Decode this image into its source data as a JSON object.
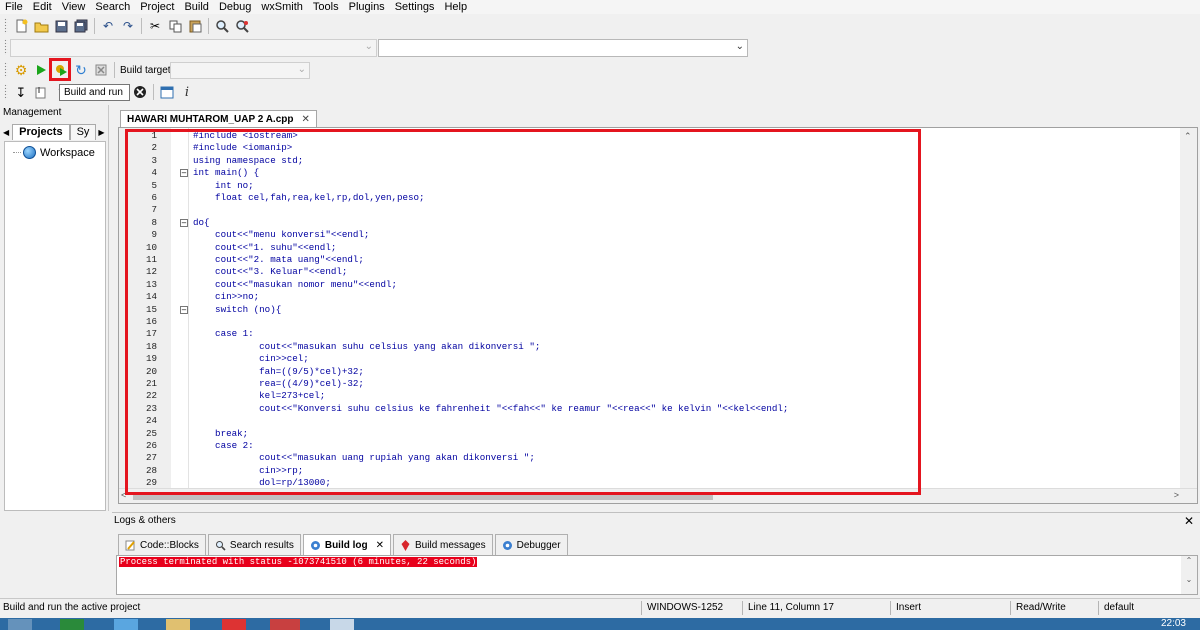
{
  "menu": [
    "File",
    "Edit",
    "View",
    "Search",
    "Project",
    "Build",
    "Debug",
    "wxSmith",
    "Tools",
    "Plugins",
    "Settings",
    "Help"
  ],
  "toolbar": {
    "build_target_label": "Build target:",
    "tooltip": "Build and run"
  },
  "management": {
    "title": "Management",
    "tabs": [
      "Projects",
      "Sy"
    ],
    "tree_root": "Workspace"
  },
  "editor": {
    "tab_label": "HAWARI MUHTAROM_UAP 2 A.cpp",
    "lines": [
      "#include <iostream>",
      "#include <iomanip>",
      "using namespace std;",
      "int main() {",
      "    int no;",
      "    float cel,fah,rea,kel,rp,dol,yen,peso;",
      "",
      "do{",
      "    cout<<\"menu konversi\"<<endl;",
      "    cout<<\"1. suhu\"<<endl;",
      "    cout<<\"2. mata uang\"<<endl;",
      "    cout<<\"3. Keluar\"<<endl;",
      "    cout<<\"masukan nomor menu\"<<endl;",
      "    cin>>no;",
      "    switch (no){",
      "",
      "    case 1:",
      "            cout<<\"masukan suhu celsius yang akan dikonversi \";",
      "            cin>>cel;",
      "            fah=((9/5)*cel)+32;",
      "            rea=((4/9)*cel)-32;",
      "            kel=273+cel;",
      "            cout<<\"Konversi suhu celsius ke fahrenheit \"<<fah<<\" ke reamur \"<<rea<<\" ke kelvin \"<<kel<<endl;",
      "",
      "    break;",
      "    case 2:",
      "            cout<<\"masukan uang rupiah yang akan dikonversi \";",
      "            cin>>rp;",
      "            dol=rp/13000;"
    ]
  },
  "logs": {
    "title": "Logs & others",
    "tabs": [
      "Code::Blocks",
      "Search results",
      "Build log",
      "Build messages",
      "Debugger"
    ],
    "active_tab": "Build log",
    "message": "Process terminated with status -1073741510 (6 minutes, 22 seconds)"
  },
  "status": {
    "hint": "Build and run the active project",
    "encoding": "WINDOWS-1252",
    "position": "Line 11, Column 17",
    "mode": "Insert",
    "access": "Read/Write",
    "profile": "default"
  },
  "taskbar": {
    "clock": "22:03"
  },
  "colors": {
    "highlight": "#e4151f",
    "error_bg": "#e8001b"
  }
}
